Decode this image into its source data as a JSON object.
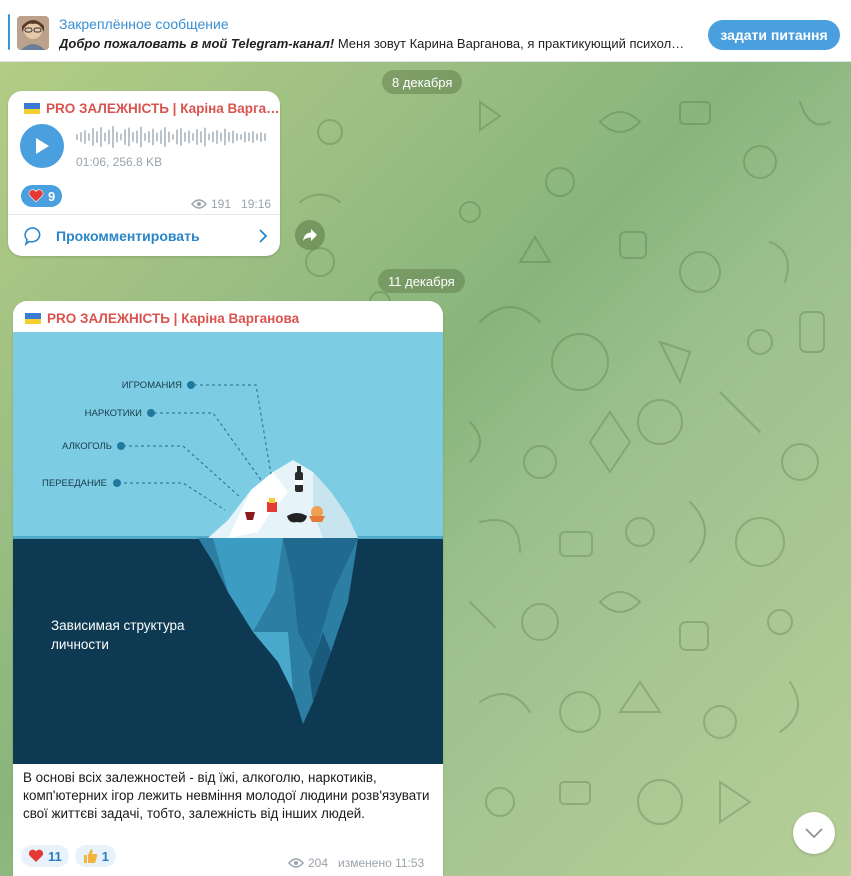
{
  "pinned": {
    "title": "Закреплённое сообщение",
    "text_bold": "Добро пожаловать в мой Telegram-канал!",
    "text_rest": " Меня зовут Карина Варганова, я практикующий психол…",
    "action_label": "задати питання"
  },
  "dates": {
    "first": "8 декабря",
    "second": "11 декабря"
  },
  "post1": {
    "sender": "PRO ЗАЛЕЖНІСТЬ | Каріна Варга…",
    "voice_meta": "01:06, 256.8 KB",
    "reaction_count": "9",
    "views": "191",
    "time": "19:16",
    "comment_label": "Прокомментировать"
  },
  "post2": {
    "sender": "PRO ЗАЛЕЖНІСТЬ | Каріна Варганова",
    "image": {
      "labels": [
        "ИГРОМАНИЯ",
        "НАРКОТИКИ",
        "АЛКОГОЛЬ",
        "ПЕРЕЕДАНИЕ"
      ],
      "title_line1": "Зависимая структура",
      "title_line2": "личности"
    },
    "caption": "В основі всіх залежностей - від їжі, алкоголю, наркотиків, комп'ютерних ігор лежить невміння молодої людини розв'язувати свої життєві задачі, тобто, залежність від інших людей.",
    "reaction_heart_count": "11",
    "reaction_thumb_count": "1",
    "views": "204",
    "edited": "изменено 11:53"
  },
  "colors": {
    "accent": "#4a9fdf",
    "sender": "#d9534f",
    "sky": "#7ccde3",
    "sea": "#0d3a52"
  }
}
